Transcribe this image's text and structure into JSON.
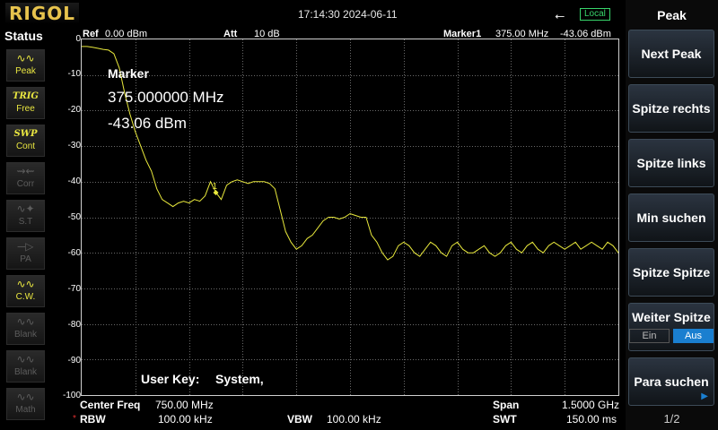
{
  "header": {
    "logo": "RIGOL",
    "datetime": "17:14:30 2024-06-11",
    "usb_icon": "usb-icon",
    "remote_state": "Local"
  },
  "status": {
    "title": "Status",
    "items": [
      {
        "label": "Peak",
        "icon": "peak-detector-icon",
        "active": true
      },
      {
        "label": "Free",
        "icon_text": "TRIG",
        "active": true
      },
      {
        "label": "Cont",
        "icon_text": "SWP",
        "active": true
      },
      {
        "label": "Corr",
        "icon": "correction-icon",
        "active": false
      },
      {
        "label": "S.T",
        "icon": "signal-track-icon",
        "active": false
      },
      {
        "label": "PA",
        "icon": "preamp-icon",
        "active": false
      },
      {
        "label": "C.W.",
        "icon": "trace-cw-icon",
        "active": true
      },
      {
        "label": "Blank",
        "icon": "trace-blank-icon",
        "active": false
      },
      {
        "label": "Blank",
        "icon": "trace-blank-icon",
        "active": false
      },
      {
        "label": "Math",
        "icon": "trace-math-icon",
        "active": false
      }
    ]
  },
  "plot": {
    "ref_label": "Ref",
    "ref_value": "0.00 dBm",
    "att_label": "Att",
    "att_value": "10 dB",
    "marker_label": "Marker1",
    "marker_freq": "375.00 MHz",
    "marker_amp": "-43.06 dBm",
    "y_ticks": [
      "0",
      "-10",
      "-20",
      "-30",
      "-40",
      "-50",
      "-60",
      "-70",
      "-80",
      "-90",
      "-100"
    ],
    "y_range": [
      -100,
      0
    ],
    "marker_number": "1",
    "trace_color": "#e8e83c"
  },
  "marker_readout": {
    "title": "Marker",
    "frequency": "375.000000 MHz",
    "amplitude": "-43.06 dBm"
  },
  "user_key": {
    "label": "User Key:",
    "value": "System,"
  },
  "bottom": {
    "center_freq_label": "Center Freq",
    "center_freq_value": "750.00 MHz",
    "span_label": "Span",
    "span_value": "1.5000 GHz",
    "rbw_star": "*",
    "rbw_label": "RBW",
    "rbw_value": "100.00 kHz",
    "vbw_label": "VBW",
    "vbw_value": "100.00 kHz",
    "swt_label": "SWT",
    "swt_value": "150.00 ms"
  },
  "menu": {
    "title": "Peak",
    "keys": [
      "Next Peak",
      "Spitze rechts",
      "Spitze links",
      "Min suchen",
      "Spitze Spitze"
    ],
    "toggle": {
      "label": "Weiter Spitze",
      "off": "Ein",
      "on": "Aus"
    },
    "last_key": "Para suchen",
    "page": "1/2"
  },
  "trace_points": [
    [
      0,
      -2
    ],
    [
      1,
      -2
    ],
    [
      2,
      -2.2
    ],
    [
      3,
      -2.5
    ],
    [
      4,
      -2.8
    ],
    [
      5,
      -3
    ],
    [
      6,
      -4
    ],
    [
      7,
      -8
    ],
    [
      8,
      -15
    ],
    [
      9,
      -21
    ],
    [
      10,
      -26
    ],
    [
      11,
      -30
    ],
    [
      12,
      -34
    ],
    [
      13,
      -37
    ],
    [
      14,
      -42
    ],
    [
      15,
      -45
    ],
    [
      16,
      -46
    ],
    [
      17,
      -47
    ],
    [
      18,
      -46
    ],
    [
      19,
      -45.5
    ],
    [
      20,
      -46
    ],
    [
      21,
      -45
    ],
    [
      22,
      -45.5
    ],
    [
      23,
      -44
    ],
    [
      24,
      -40
    ],
    [
      25,
      -43
    ],
    [
      26,
      -45
    ],
    [
      27,
      -41
    ],
    [
      28,
      -40
    ],
    [
      29,
      -39.5
    ],
    [
      30,
      -40
    ],
    [
      31,
      -40.5
    ],
    [
      32,
      -40
    ],
    [
      33,
      -40
    ],
    [
      34,
      -40
    ],
    [
      35,
      -40.5
    ],
    [
      36,
      -42
    ],
    [
      37,
      -48
    ],
    [
      38,
      -54
    ],
    [
      39,
      -57
    ],
    [
      40,
      -59
    ],
    [
      41,
      -58
    ],
    [
      42,
      -56
    ],
    [
      43,
      -55
    ],
    [
      44,
      -53
    ],
    [
      45,
      -51
    ],
    [
      46,
      -50
    ],
    [
      47,
      -50
    ],
    [
      48,
      -50.5
    ],
    [
      49,
      -50
    ],
    [
      50,
      -49
    ],
    [
      51,
      -49.5
    ],
    [
      52,
      -50
    ],
    [
      53,
      -50
    ],
    [
      54,
      -55
    ],
    [
      55,
      -57
    ],
    [
      56,
      -60
    ],
    [
      57,
      -62
    ],
    [
      58,
      -61
    ],
    [
      59,
      -58
    ],
    [
      60,
      -57
    ],
    [
      61,
      -58
    ],
    [
      62,
      -60
    ],
    [
      63,
      -61
    ],
    [
      64,
      -59
    ],
    [
      65,
      -57
    ],
    [
      66,
      -58
    ],
    [
      67,
      -60
    ],
    [
      68,
      -61
    ],
    [
      69,
      -58
    ],
    [
      70,
      -57
    ],
    [
      71,
      -59
    ],
    [
      72,
      -60
    ],
    [
      73,
      -60
    ],
    [
      74,
      -59
    ],
    [
      75,
      -58
    ],
    [
      76,
      -60
    ],
    [
      77,
      -61
    ],
    [
      78,
      -60
    ],
    [
      79,
      -58
    ],
    [
      80,
      -57
    ],
    [
      81,
      -59
    ],
    [
      82,
      -60
    ],
    [
      83,
      -58
    ],
    [
      84,
      -57
    ],
    [
      85,
      -59
    ],
    [
      86,
      -60
    ],
    [
      87,
      -58
    ],
    [
      88,
      -57
    ],
    [
      89,
      -58
    ],
    [
      90,
      -59
    ],
    [
      91,
      -58
    ],
    [
      92,
      -57
    ],
    [
      93,
      -59
    ],
    [
      94,
      -58
    ],
    [
      95,
      -57
    ],
    [
      96,
      -58
    ],
    [
      97,
      -59
    ],
    [
      98,
      -57
    ],
    [
      99,
      -58
    ],
    [
      100,
      -60
    ]
  ]
}
